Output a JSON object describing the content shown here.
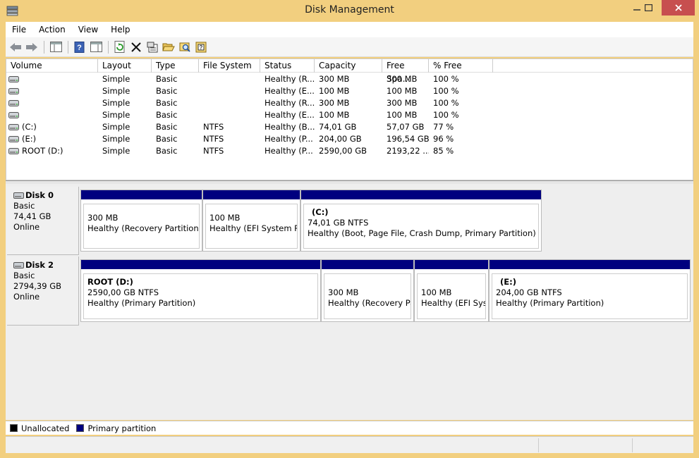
{
  "window": {
    "title": "Disk Management",
    "accent": "#f2cf7f",
    "close_color": "#c74f4f"
  },
  "menu": [
    "File",
    "Action",
    "View",
    "Help"
  ],
  "toolbar": [
    "back-icon",
    "forward-icon",
    "console-tree-icon",
    "help-icon",
    "show-hide-icon",
    "refresh-icon",
    "delete-icon",
    "properties-icon",
    "open-icon",
    "explore-icon",
    "help-topics-icon"
  ],
  "columns": [
    "Volume",
    "Layout",
    "Type",
    "File System",
    "Status",
    "Capacity",
    "Free Spa...",
    "% Free"
  ],
  "volumes": [
    {
      "name": "",
      "layout": "Simple",
      "type": "Basic",
      "fs": "",
      "status": "Healthy (R...",
      "capacity": "300 MB",
      "free": "300 MB",
      "pct": "100 %"
    },
    {
      "name": "",
      "layout": "Simple",
      "type": "Basic",
      "fs": "",
      "status": "Healthy (E...",
      "capacity": "100 MB",
      "free": "100 MB",
      "pct": "100 %"
    },
    {
      "name": "",
      "layout": "Simple",
      "type": "Basic",
      "fs": "",
      "status": "Healthy (R...",
      "capacity": "300 MB",
      "free": "300 MB",
      "pct": "100 %"
    },
    {
      "name": "",
      "layout": "Simple",
      "type": "Basic",
      "fs": "",
      "status": "Healthy (E...",
      "capacity": "100 MB",
      "free": "100 MB",
      "pct": "100 %"
    },
    {
      "name": "(C:)",
      "layout": "Simple",
      "type": "Basic",
      "fs": "NTFS",
      "status": "Healthy (B...",
      "capacity": "74,01 GB",
      "free": "57,07 GB",
      "pct": "77 %"
    },
    {
      "name": "(E:)",
      "layout": "Simple",
      "type": "Basic",
      "fs": "NTFS",
      "status": "Healthy (P...",
      "capacity": "204,00 GB",
      "free": "196,54 GB",
      "pct": "96 %"
    },
    {
      "name": "ROOT (D:)",
      "layout": "Simple",
      "type": "Basic",
      "fs": "NTFS",
      "status": "Healthy (P...",
      "capacity": "2590,00 GB",
      "free": "2193,22 ...",
      "pct": "85 %"
    }
  ],
  "disks": [
    {
      "name": "Disk 0",
      "kind": "Basic",
      "size": "74,41 GB",
      "state": "Online",
      "partitions": [
        {
          "name": "",
          "size": "300 MB",
          "status": "Healthy (Recovery Partition)"
        },
        {
          "name": "",
          "size": "100 MB",
          "status": "Healthy (EFI System Par"
        },
        {
          "name": "(C:)",
          "size": "74,01 GB NTFS",
          "status": "Healthy (Boot, Page File, Crash Dump, Primary Partition)"
        }
      ]
    },
    {
      "name": "Disk 2",
      "kind": "Basic",
      "size": "2794,39 GB",
      "state": "Online",
      "partitions": [
        {
          "name": "ROOT  (D:)",
          "size": "2590,00 GB NTFS",
          "status": "Healthy (Primary Partition)"
        },
        {
          "name": "",
          "size": "300 MB",
          "status": "Healthy (Recovery Par"
        },
        {
          "name": "",
          "size": "100 MB",
          "status": "Healthy (EFI Syste"
        },
        {
          "name": "(E:)",
          "size": "204,00 GB NTFS",
          "status": "Healthy (Primary Partition)"
        }
      ]
    }
  ],
  "legend": [
    {
      "label": "Unallocated",
      "color": "#000000"
    },
    {
      "label": "Primary partition",
      "color": "#00007f"
    }
  ]
}
